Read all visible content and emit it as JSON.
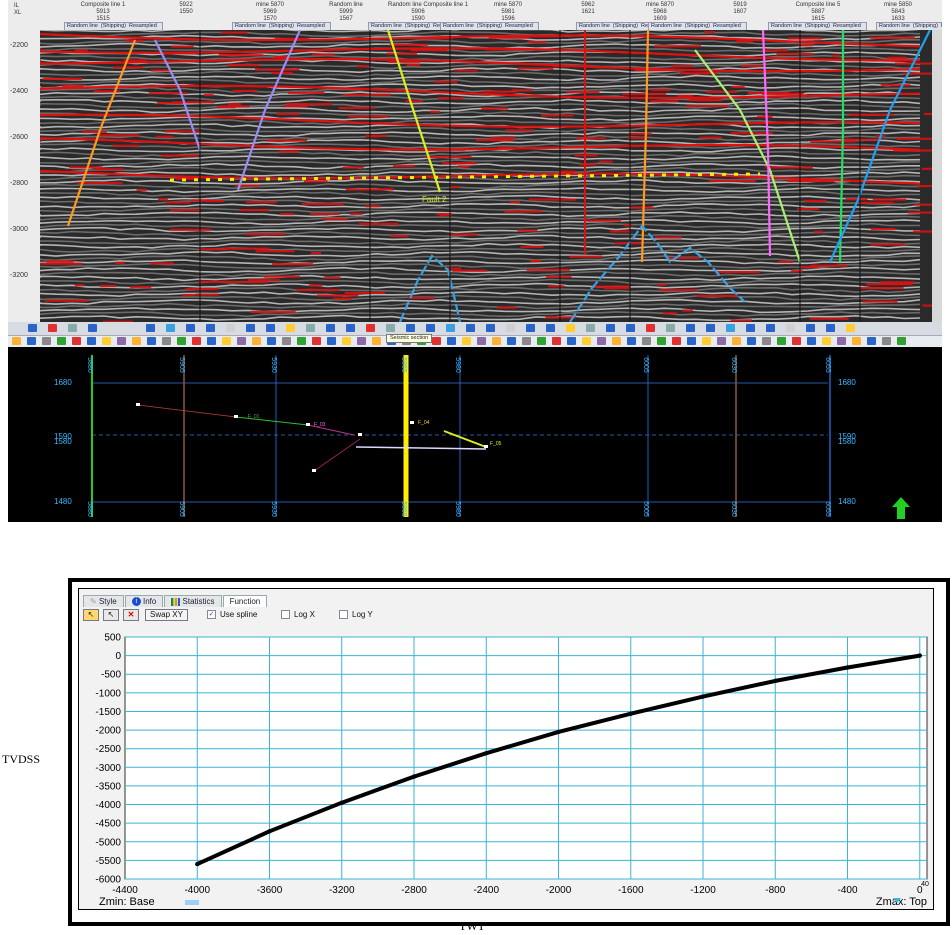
{
  "seismic_header": {
    "row_labels": [
      "IL",
      "XL"
    ],
    "columns": [
      {
        "label": "Composite line 1",
        "il": "5913",
        "xl": "1515"
      },
      {
        "label": "",
        "il": "5922",
        "xl": "1550"
      },
      {
        "label": "mine 5870",
        "il": "5969",
        "xl": "1570"
      },
      {
        "label": "Random line",
        "il": "5999",
        "xl": "1567"
      },
      {
        "label": "Random line Composite line 1",
        "il": "5906",
        "xl": "1590"
      },
      {
        "label": "mine 5870",
        "il": "5981",
        "xl": "1596"
      },
      {
        "label": "",
        "il": "5962",
        "xl": "1621"
      },
      {
        "label": "mine 5870",
        "il": "5968",
        "xl": "1609"
      },
      {
        "label": "",
        "il": "5919",
        "xl": "1607"
      },
      {
        "label": "Composite line 5",
        "il": "5887",
        "xl": "1615"
      },
      {
        "label": "mine 5850",
        "il": "5843",
        "xl": "1633"
      }
    ],
    "tab_labels": [
      "Random line",
      "(Shipping)",
      "Resampled"
    ]
  },
  "seismic": {
    "y_ticks": [
      "-2200",
      "-2400",
      "-2600",
      "-2800",
      "-3000",
      "-3200"
    ],
    "fault_colors": [
      "#ff9a1f",
      "#9a8cf5",
      "#9a8cf5",
      "#d8f020",
      "#ff9a1f",
      "#aaf070",
      "#ff66ff",
      "#20e060",
      "#20a0f0"
    ],
    "horizon_color": "#e01010",
    "marker_color": "#ffee00",
    "basement_color": "#3aa0e0",
    "fault_label": "Fault 2"
  },
  "mapview": {
    "left_ticks": [
      "1680",
      "1590",
      "1580",
      "1480"
    ],
    "right_ticks": [
      "1680",
      "1590",
      "1580",
      "1480"
    ],
    "inline_labels": [
      "5880",
      "5905",
      "5930",
      "5955",
      "5980",
      "6005",
      "6030",
      "6055"
    ],
    "tooltip": "Seismic section",
    "well_labels": [
      "F_01",
      "F_03",
      "F_04",
      "F_05"
    ],
    "colors": {
      "grid": "#2a5aa8",
      "highlight": "#ffee00",
      "inline": "#1c62c8",
      "brown": "#8a5a3a",
      "green": "#22cc22",
      "label": "#3ab7ff"
    }
  },
  "function_panel": {
    "tabs": [
      "Style",
      "Info",
      "Statistics",
      "Function"
    ],
    "active_tab": "Function",
    "swap_label": "Swap XY",
    "use_spline_label": "Use spline",
    "use_spline_checked": true,
    "logx_label": "Log X",
    "logy_label": "Log Y",
    "zmin_label": "Zmin: Base",
    "zmax_label": "Zmax: Top",
    "outer_ylabel": "TVDSS",
    "outer_xlabel": "TWT"
  },
  "chart_data": {
    "type": "line",
    "title": "",
    "xlabel": "TWT",
    "ylabel": "TVDSS",
    "xlim": [
      -4400,
      40
    ],
    "ylim": [
      -6000,
      500
    ],
    "x_ticks": [
      -4400,
      -4000,
      -3600,
      -3200,
      -2800,
      -2400,
      -2000,
      -1600,
      -1200,
      -800,
      -400,
      0
    ],
    "x_tick_labels": [
      "-4400",
      "-4000",
      "-3600",
      "-3200",
      "-2800",
      "-2400",
      "-2000",
      "-1600",
      "-1200",
      "-800",
      "-400",
      "0"
    ],
    "edge_tick_label": "40",
    "y_ticks": [
      500,
      0,
      -500,
      -1000,
      -1500,
      -2000,
      -2500,
      -3000,
      -3500,
      -4000,
      -4500,
      -5000,
      -5500,
      -6000
    ],
    "y_tick_labels": [
      "500",
      "0",
      "-500",
      "-1000",
      "-1500",
      "-2000",
      "-2500",
      "-3000",
      "-3500",
      "-4000",
      "-4500",
      "-5000",
      "-5500",
      "-6000"
    ],
    "grid": true,
    "series": [
      {
        "x": [
          -4000,
          -3600,
          -3200,
          -2800,
          -2400,
          -2000,
          -1600,
          -1200,
          -800,
          -400,
          0
        ],
        "y": [
          -5600,
          -4720,
          -3950,
          -3250,
          -2620,
          -2050,
          -1560,
          -1100,
          -680,
          -320,
          0
        ]
      }
    ]
  }
}
